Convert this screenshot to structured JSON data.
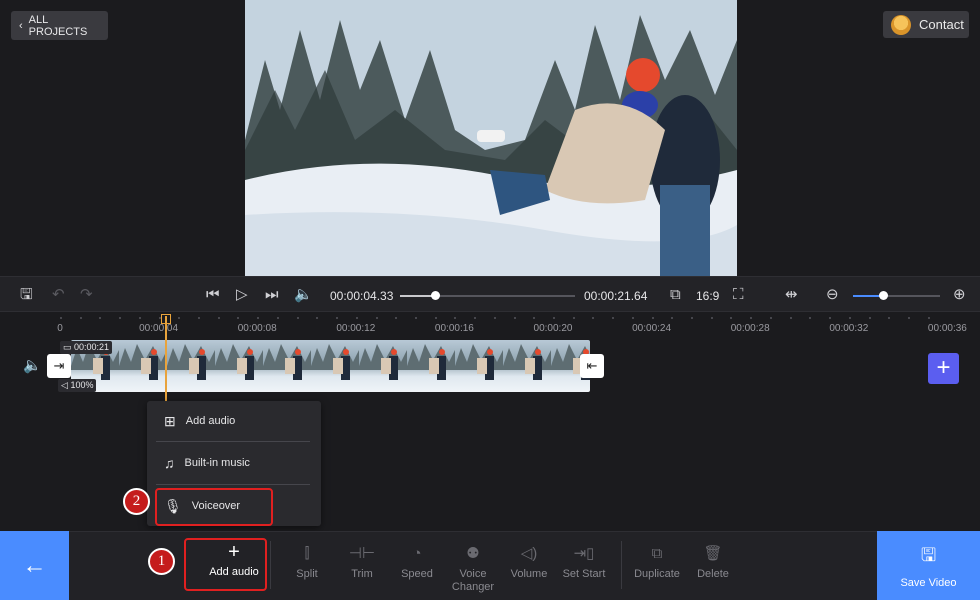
{
  "header": {
    "back_label": "ALL PROJECTS",
    "contact_label": "Contact"
  },
  "player": {
    "current_time": "00:00:04.33",
    "total_time": "00:00:21.64",
    "aspect_ratio": "16:9",
    "progress_fraction": 0.2,
    "zoom_fraction": 0.35
  },
  "ruler": {
    "labels": [
      "0",
      "00:00:04",
      "00:00:08",
      "00:00:12",
      "00:00:16",
      "00:00:20",
      "00:00:24",
      "00:00:28",
      "00:00:32",
      "00:00:36"
    ]
  },
  "clip": {
    "duration": "00:00:21",
    "volume": "100%"
  },
  "add_menu": {
    "items": [
      {
        "label": "Add audio",
        "icon": "add-file-icon"
      },
      {
        "label": "Built-in music",
        "icon": "music-note-icon"
      },
      {
        "label": "Voiceover",
        "icon": "microphone-icon"
      }
    ],
    "step_2": "2"
  },
  "toolbar": {
    "step_1": "1",
    "add_audio": "Add audio",
    "split": "Split",
    "trim": "Trim",
    "speed": "Speed",
    "voice_changer": "Voice Changer",
    "volume": "Volume",
    "set_start": "Set Start",
    "duplicate": "Duplicate",
    "delete": "Delete",
    "save_video": "Save Video"
  },
  "colors": {
    "accent": "#4a8cff",
    "add_track": "#5b5ef0",
    "playhead": "#e8a33c",
    "highlight": "#e02020"
  }
}
